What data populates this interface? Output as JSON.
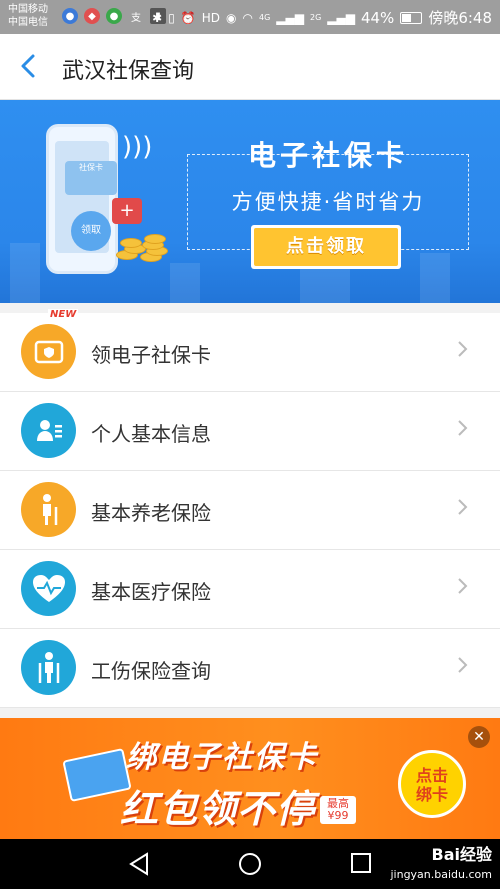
{
  "status_bar": {
    "carrier1": "中国移动",
    "carrier2": "中国电信",
    "notif_text": "支",
    "network_4g": "4G",
    "network_2g": "2G",
    "hd": "HD",
    "battery": "44%",
    "time": "傍晚6:48"
  },
  "header": {
    "back_icon": "chevron-left-icon",
    "title": "武汉社保查询"
  },
  "banner": {
    "card_title": "电子社保卡",
    "subtitle": "方便快捷·省时省力",
    "button": "点击领取",
    "phone_card_label": "社保卡",
    "phone_claim_label": "领取",
    "bg_color": "#2b86ea"
  },
  "menu": [
    {
      "label": "领电子社保卡",
      "icon": "id-card-icon",
      "color": "#f7a828",
      "badge": "NEW"
    },
    {
      "label": "个人基本信息",
      "icon": "person-info-icon",
      "color": "#21a7d9"
    },
    {
      "label": "基本养老保险",
      "icon": "elderly-person-icon",
      "color": "#f7a828"
    },
    {
      "label": "基本医疗保险",
      "icon": "heart-pulse-icon",
      "color": "#21a7d9"
    },
    {
      "label": "工伤保险查询",
      "icon": "injured-person-icon",
      "color": "#21a7d9"
    }
  ],
  "promo": {
    "line1": "绑电子社保卡",
    "line2": "红包领不停",
    "tag_top": "最高",
    "tag_amount": "¥99",
    "button_line1": "点击",
    "button_line2": "绑卡",
    "close_icon": "close-icon"
  },
  "navbar": {
    "back_icon": "triangle-back-icon",
    "home_icon": "circle-home-icon",
    "recent_icon": "square-recent-icon",
    "watermark": "Bai经验",
    "watermark_sub": "jingyan.baidu.com"
  }
}
